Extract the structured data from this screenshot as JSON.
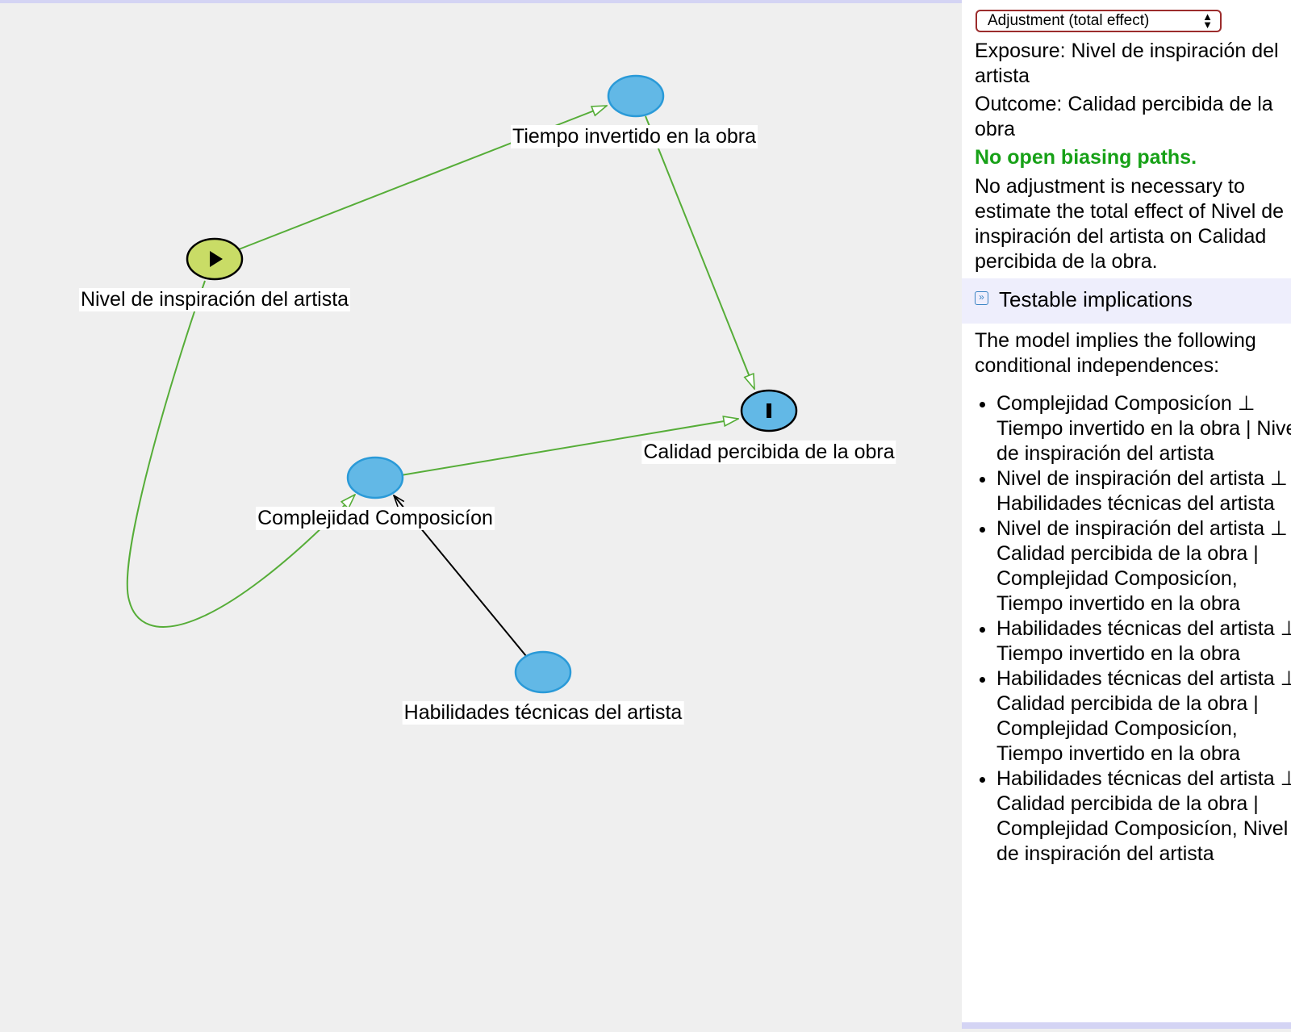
{
  "graph": {
    "nodes": [
      {
        "id": "exposure",
        "label": "Nivel de inspiración del artista",
        "role": "exposure"
      },
      {
        "id": "tiempo",
        "label": "Tiempo invertido en la obra",
        "role": "other"
      },
      {
        "id": "outcome",
        "label": "Calidad percibida de la obra",
        "role": "outcome"
      },
      {
        "id": "complejidad",
        "label": "Complejidad Composicíon",
        "role": "other"
      },
      {
        "id": "habilidades",
        "label": "Habilidades técnicas del artista",
        "role": "other"
      }
    ],
    "edges": [
      {
        "from": "exposure",
        "to": "tiempo",
        "type": "causal"
      },
      {
        "from": "tiempo",
        "to": "outcome",
        "type": "causal"
      },
      {
        "from": "exposure",
        "to": "complejidad",
        "type": "causal"
      },
      {
        "from": "complejidad",
        "to": "outcome",
        "type": "causal"
      },
      {
        "from": "habilidades",
        "to": "complejidad",
        "type": "other"
      }
    ],
    "colors": {
      "node_fill": "#62b8e6",
      "node_stroke": "#2a9ad8",
      "exposure_fill": "#c9dc66",
      "causal_edge": "#56ad38",
      "other_edge": "#000000"
    }
  },
  "panel": {
    "select_value": "Adjustment (total effect)",
    "exposure_text": "Exposure: Nivel de inspiración del artista",
    "outcome_text": "Outcome: Calidad percibida de la obra",
    "status": "No open biasing paths.",
    "description": "No adjustment is necessary to estimate the total effect of Nivel de inspiración del artista on Calidad percibida de la obra.",
    "section_title": "Testable implications",
    "intro": "The model implies the following conditional independences:",
    "implications": [
      "Complejidad Composicíon ⊥ Tiempo invertido en la obra | Nivel de inspiración del artista",
      "Nivel de inspiración del artista ⊥ Habilidades técnicas del artista",
      "Nivel de inspiración del artista ⊥ Calidad percibida de la obra | Complejidad Composicíon, Tiempo invertido en la obra",
      "Habilidades técnicas del artista ⊥ Tiempo invertido en la obra",
      "Habilidades técnicas del artista ⊥ Calidad percibida de la obra | Complejidad Composicíon, Tiempo invertido en la obra",
      "Habilidades técnicas del artista ⊥ Calidad percibida de la obra | Complejidad Composicíon, Nivel de inspiración del artista"
    ]
  }
}
